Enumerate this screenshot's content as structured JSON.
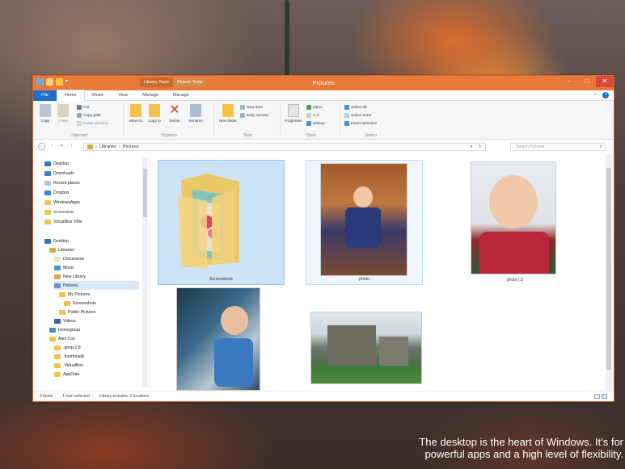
{
  "window": {
    "title": "Pictures",
    "contextual_tabs": [
      "Library Tools",
      "Picture Tools"
    ],
    "minimize": "–",
    "maximize": "□",
    "close": "✕"
  },
  "ribbon_tabs": [
    "File",
    "Home",
    "Share",
    "View",
    "Manage",
    "Manage"
  ],
  "ribbon": {
    "clipboard": {
      "label": "Clipboard",
      "copy": "Copy",
      "paste": "Paste",
      "cut": "Cut",
      "copy_path": "Copy path",
      "paste_shortcut": "Paste shortcut"
    },
    "organize": {
      "label": "Organize",
      "move_to": "Move to",
      "copy_to": "Copy to",
      "delete": "Delete",
      "rename": "Rename"
    },
    "new": {
      "label": "New",
      "new_folder": "New folder",
      "new_item": "New item",
      "easy_access": "Easy access"
    },
    "open": {
      "label": "Open",
      "properties": "Properties",
      "open": "Open",
      "edit": "Edit",
      "history": "History"
    },
    "select": {
      "label": "Select",
      "select_all": "Select all",
      "select_none": "Select none",
      "invert_selection": "Invert selection"
    }
  },
  "address": {
    "crumbs": [
      "Libraries",
      "Pictures"
    ],
    "search_placeholder": "Search Pictures"
  },
  "sidebar": {
    "favorites": [
      "Desktop",
      "Downloads",
      "Recent places",
      "Dropbox",
      "WindowsApps",
      "Screenshots",
      "VirtualBox VMs"
    ],
    "tree": [
      "Desktop",
      "Libraries",
      "Documents",
      "Music",
      "New Library",
      "Pictures",
      "My Pictures",
      "Screenshots",
      "Public Pictures",
      "Videos",
      "Homegroup",
      "Alex Cox",
      ".gimp-2.8",
      ".thumbnails",
      ".VirtualBox",
      "AppData"
    ]
  },
  "items": [
    {
      "name": "Screenshots",
      "kind": "folder"
    },
    {
      "name": "photo",
      "kind": "photo"
    },
    {
      "name": "photo (1)",
      "kind": "photo"
    },
    {
      "name": "",
      "kind": "photo"
    },
    {
      "name": "",
      "kind": "photo"
    }
  ],
  "status": {
    "count": "5 items",
    "selected": "1 item selected",
    "library": "Library includes: 2 locations"
  },
  "caption": {
    "line1": "The desktop is the heart of Windows. It’s for",
    "line2": "powerful apps and a high level of flexibility."
  },
  "colors": {
    "titlebar": "#e87a3a",
    "file_tab": "#1f6fc6",
    "close": "#d94a3a"
  }
}
